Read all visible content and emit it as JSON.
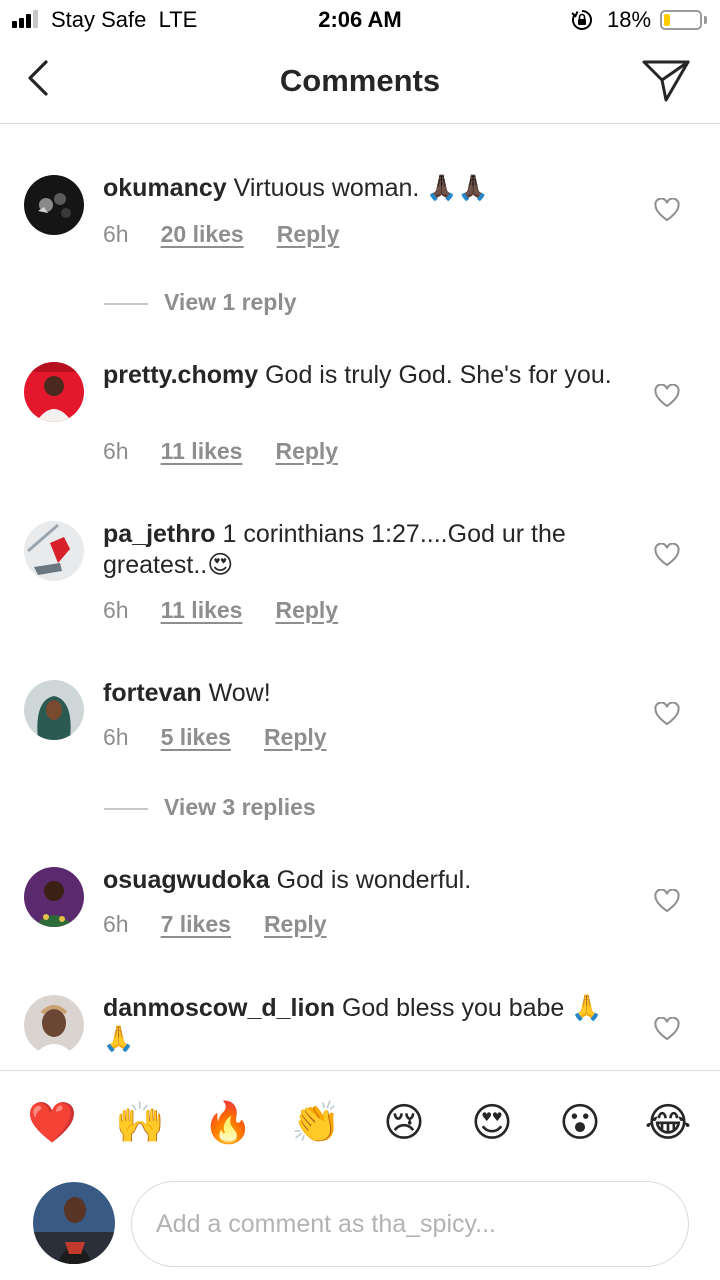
{
  "status_bar": {
    "carrier": "Stay Safe",
    "network": "LTE",
    "time": "2:06 AM",
    "battery": "18%",
    "battery_level": 0.18,
    "icons": [
      "signal-icon",
      "orientation-lock-icon",
      "battery-icon"
    ]
  },
  "header": {
    "title": "Comments",
    "back_icon": "chevron-left-icon",
    "share_icon": "paper-plane-icon"
  },
  "comments": [
    {
      "username": "okumancy",
      "text": "Virtuous woman. 🙏🏿🙏🏿",
      "time": "6h",
      "likes": "20 likes",
      "reply": "Reply"
    },
    {
      "username": "pretty.chomy",
      "text": "God is truly God. She's for you.",
      "time": "6h",
      "likes": "11 likes",
      "reply": "Reply"
    },
    {
      "username": "pa_jethro",
      "text": "1 corinthians 1:27....God ur the greatest..😍",
      "time": "6h",
      "likes": "11 likes",
      "reply": "Reply"
    },
    {
      "username": "fortevan",
      "text": "Wow!",
      "time": "6h",
      "likes": "5 likes",
      "reply": "Reply"
    },
    {
      "username": "osuagwudoka",
      "text": "God is wonderful.",
      "time": "6h",
      "likes": "7 likes",
      "reply": "Reply"
    },
    {
      "username": "danmoscow_d_lion",
      "text": "God bless you babe 🙏🙏"
    }
  ],
  "view_replies": [
    "View 1 reply",
    "View 3 replies"
  ],
  "emoji_bar": [
    "❤️",
    "🙌",
    "🔥",
    "👏",
    "😢",
    "😍",
    "😮",
    "😂"
  ],
  "composer": {
    "placeholder": "Add a comment as tha_spicy..."
  },
  "colors": {
    "text": "#262626",
    "secondary": "#8e8e8e",
    "divider": "#dbdbdb",
    "battery": "#ffcc00"
  }
}
